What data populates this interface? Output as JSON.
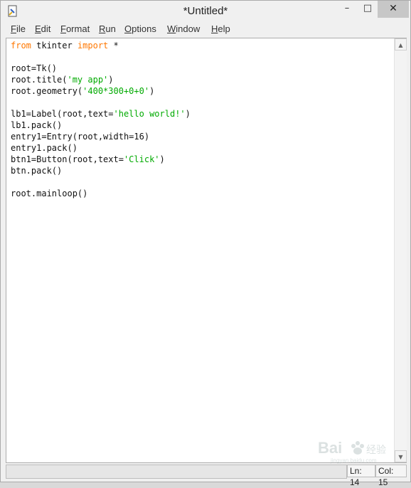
{
  "window": {
    "title": "*Untitled*",
    "controls": {
      "minimize": "–",
      "maximize": "□",
      "close": "✕"
    }
  },
  "menu": [
    "File",
    "Edit",
    "Format",
    "Run",
    "Options",
    "Window",
    "Help"
  ],
  "code_lines": [
    [
      {
        "t": "from",
        "c": "kw"
      },
      {
        "t": " tkinter "
      },
      {
        "t": "import",
        "c": "kw"
      },
      {
        "t": " *"
      }
    ],
    [],
    [
      {
        "t": "root=Tk()"
      }
    ],
    [
      {
        "t": "root.title("
      },
      {
        "t": "'my app'",
        "c": "str"
      },
      {
        "t": ")"
      }
    ],
    [
      {
        "t": "root.geometry("
      },
      {
        "t": "'400*300+0+0'",
        "c": "str"
      },
      {
        "t": ")"
      }
    ],
    [],
    [
      {
        "t": "lb1=Label(root,text="
      },
      {
        "t": "'hello world!'",
        "c": "str"
      },
      {
        "t": ")"
      }
    ],
    [
      {
        "t": "lb1.pack()"
      }
    ],
    [
      {
        "t": "entry1=Entry(root,width=16)"
      }
    ],
    [
      {
        "t": "entry1.pack()"
      }
    ],
    [
      {
        "t": "btn1=Button(root,text="
      },
      {
        "t": "'Click'",
        "c": "str"
      },
      {
        "t": ")"
      }
    ],
    [
      {
        "t": "btn.pack()"
      }
    ],
    [],
    [
      {
        "t": "root.mainloop()"
      }
    ]
  ],
  "status": {
    "line": "Ln: 14",
    "column": "Col: 15"
  },
  "watermark": {
    "text": "Bai",
    "sub": "经验",
    "url": "jingyan.baidu.com"
  },
  "colors": {
    "keyword": "#ff7700",
    "string": "#00aa00",
    "text": "#111111"
  }
}
